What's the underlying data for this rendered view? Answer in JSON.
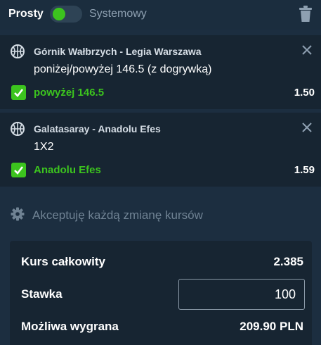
{
  "mode": {
    "left_label": "Prosty",
    "right_label": "Systemowy"
  },
  "bets": [
    {
      "match": "Górnik Wałbrzych - Legia Warszawa",
      "market": "poniżej/powyżej 146.5 (z dogrywką)",
      "selection": "powyżej 146.5",
      "odds": "1.50"
    },
    {
      "match": "Galatasaray - Anadolu Efes",
      "market": "1X2",
      "selection": "Anadolu Efes",
      "odds": "1.59"
    }
  ],
  "accept_changes_label": "Akceptuję każdą zmianę kursów",
  "summary": {
    "total_odds_label": "Kurs całkowity",
    "total_odds": "2.385",
    "stake_label": "Stawka",
    "stake_value": "100",
    "possible_win_label": "Możliwa wygrana",
    "possible_win": "209.90 PLN"
  },
  "colors": {
    "accent_green": "#3cc41e",
    "background": "#1c2e40",
    "panel": "#172532"
  },
  "icons": [
    "basketball-icon",
    "close-icon",
    "checkbox-checked-icon",
    "gear-icon",
    "trash-icon"
  ]
}
